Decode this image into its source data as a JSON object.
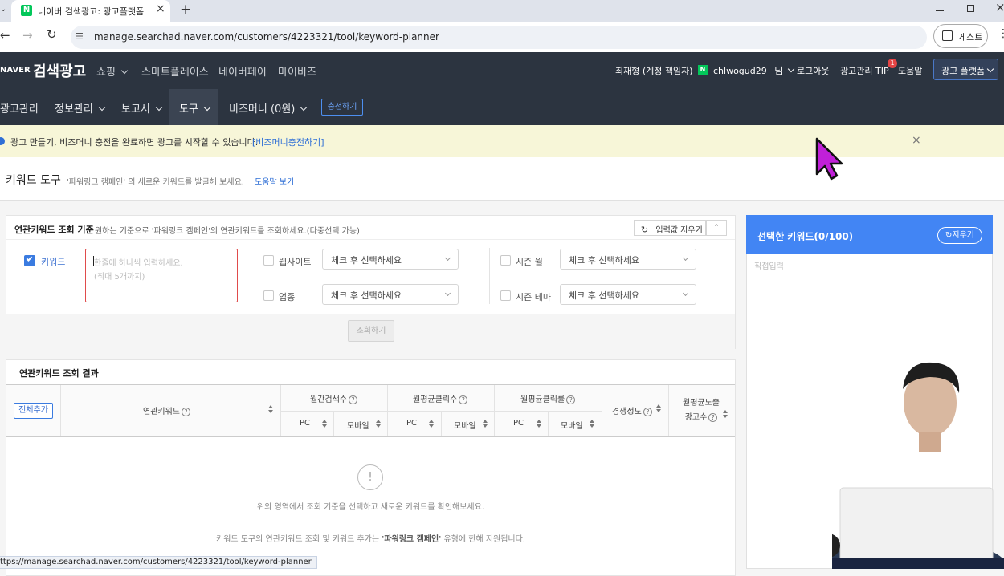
{
  "browser": {
    "tab_title": "네이버 검색광고: 광고플랫폼",
    "new_tab": "+",
    "url": "manage.searchad.naver.com/customers/4223321/tool/keyword-planner",
    "guest_label": "게스트",
    "status_url": "ttps://manage.searchad.naver.com/customers/4223321/tool/keyword-planner"
  },
  "topnav": {
    "logo": "검색광고",
    "logo_prefix": "NAVER",
    "items": [
      "쇼핑",
      "스마트플레이스",
      "네이버페이",
      "마이비즈"
    ],
    "user_name": "최재형 (계정 책임자)",
    "user_id": "chlwogud29",
    "user_suffix": "님",
    "logout": "로그아웃",
    "tip": "광고관리 TIP",
    "tip_badge": "1",
    "help": "도움말",
    "platform_btn": "광고 플랫폼"
  },
  "subnav": {
    "items": [
      "광고관리",
      "정보관리",
      "보고서",
      "도구",
      "비즈머니 (0원)"
    ],
    "charge_btn": "충전하기"
  },
  "notice": {
    "text": "광고 만들기, 비즈머니 충전을 완료하면 광고를 시작할 수 있습니다.",
    "link": "[비즈머니충전하기]"
  },
  "page": {
    "title": "키워드 도구",
    "desc": "'파워링크 캠페인' 의 새로운 키워드를 발굴해 보세요.",
    "help_link": "도움말 보기"
  },
  "criteria": {
    "header_title": "연관키워드 조회 기준",
    "header_desc": "원하는 기준으로 '파워링크 캠페인'의 연관키워드를 조회하세요.(다중선택 가능)",
    "reset_btn": "입력값 지우기",
    "keyword_label": "키워드",
    "keyword_placeholder_1": "한줄에 하나씩 입력하세요.",
    "keyword_placeholder_2": "(최대 5개까지)",
    "website_label": "웹사이트",
    "industry_label": "업종",
    "season_month_label": "시즌 월",
    "season_theme_label": "시즌 테마",
    "select_placeholder": "체크 후 선택하세요",
    "search_btn": "조회하기"
  },
  "results": {
    "title": "연관키워드 조회 결과",
    "add_all_btn": "전체추가",
    "col_keyword": "연관키워드",
    "col_monthly_search": "월간검색수",
    "col_avg_clicks": "월평균클릭수",
    "col_avg_ctr": "월평균클릭률",
    "col_competition": "경쟁정도",
    "col_ad_exposure_1": "월평균노출",
    "col_ad_exposure_2": "광고수",
    "pc": "PC",
    "mobile": "모바일",
    "empty_icon": "!",
    "empty_msg": "위의 영역에서 조회 기준을 선택하고 새로운 키워드를 확인해보세요.",
    "footer_msg_1": "키워드 도구의 연관키워드 조회 및 키워드 추가는 ",
    "footer_msg_bold": "'파워링크 캠페인'",
    "footer_msg_2": " 유형에 한해 지원됩니다."
  },
  "selected": {
    "title": "선택한 키워드(0/100)",
    "clear_btn": "지우기",
    "direct_input": "직접입력"
  },
  "colors": {
    "nav_bg": "#2c3440",
    "accent": "#4285f4",
    "notice_bg": "#f7f6d8",
    "link": "#2f6fd6"
  }
}
